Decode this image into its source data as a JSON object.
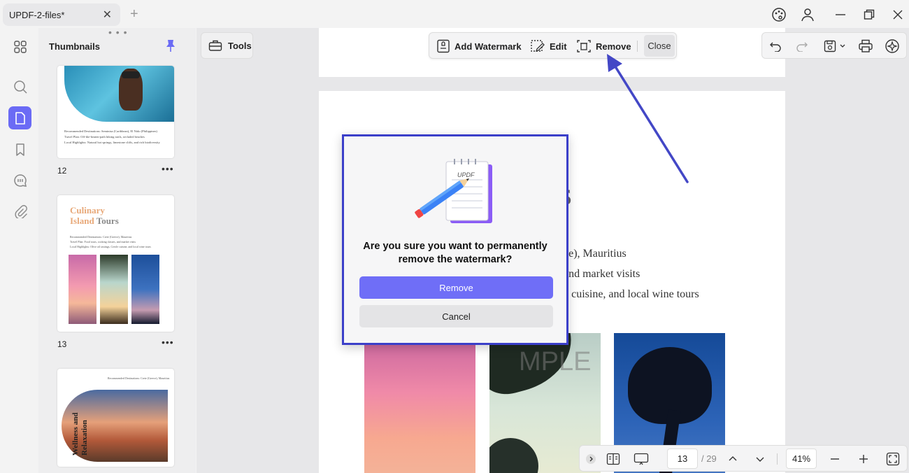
{
  "tab": {
    "title": "UPDF-2-files*"
  },
  "thumbnails": {
    "header": "Thumbnails",
    "pages": [
      {
        "number": "12",
        "caption_lines": [
          "Recommended Destinations: Seminisa (Caribbean), El Nido (Philippines)",
          "Travel Plan: Off-the-beaten-path hiking trails, secluded beaches",
          "Local Highlights: Natural hot springs, limestone cliffs, and rich biodiversity"
        ]
      },
      {
        "number": "13",
        "title_line1": "Culinary",
        "title_line2a": "Island ",
        "title_line2b": "Tours",
        "caption_lines": [
          "Recommended Destinations: Crete (Greece), Mauritius",
          "Travel Plan: Food tours, cooking classes, and market visits",
          "Local Highlights: Olive oil tastings, Creole cuisine, and local wine tours"
        ]
      },
      {
        "number": "",
        "vertical_title": "Wellness and Relaxation",
        "header_line": "Recommended Destinations: Crete (Greece), Mauritius"
      }
    ]
  },
  "toolbar": {
    "tools_label": "Tools",
    "add_watermark_label": "Add Watermark",
    "edit_label": "Edit",
    "remove_label": "Remove",
    "close_label": "Close"
  },
  "document": {
    "heading_fragment": "rs",
    "lines": [
      "ce), Mauritius",
      "and market visits",
      "e cuisine, and local wine tours"
    ],
    "watermark_fragment": "MPLE"
  },
  "dialog": {
    "message": "Are you sure you want to permanently remove the watermark?",
    "confirm_label": "Remove",
    "cancel_label": "Cancel",
    "icon_text": "UPDF"
  },
  "pagination": {
    "current_page": "13",
    "total_pages": "/ 29",
    "zoom": "41%"
  },
  "colors": {
    "accent": "#6b6bf5",
    "dialog_border": "#3b3fc9",
    "arrow": "#4347c6",
    "pin": "#6b6bf5"
  }
}
